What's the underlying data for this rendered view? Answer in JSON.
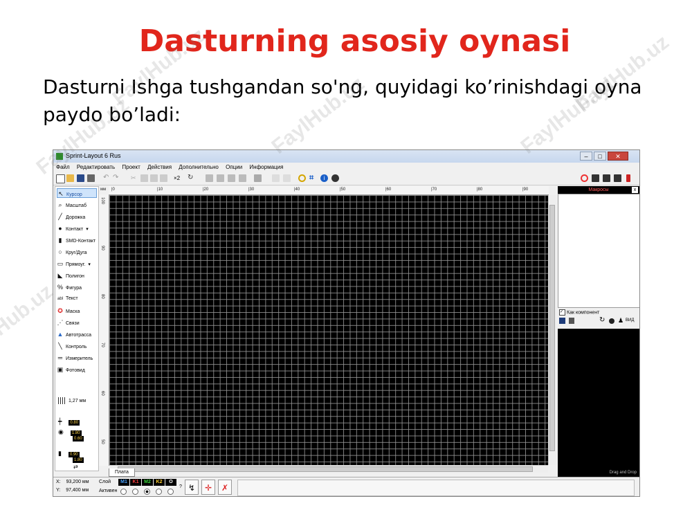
{
  "slide": {
    "title": "Dasturning asosiy oynasi",
    "intro": "Dasturni Ishga tushgandan so'ng, quyidagi ko’rinishdagi oyna paydo bo’ladi:",
    "watermark": "FaylHub.uz",
    "title_color": "#e1261c"
  },
  "window": {
    "title": "Sprint-Layout 6 Rus",
    "controls": [
      "–",
      "□",
      "✕"
    ]
  },
  "menu": [
    "Файл",
    "Редактировать",
    "Проект",
    "Действия",
    "Дополнительно",
    "Опции",
    "Информация"
  ],
  "toolbar": {
    "zoom_label": "×2"
  },
  "tools": [
    {
      "label": "Курсор",
      "icon": "cursor-icon",
      "glyph": "↖",
      "active": true
    },
    {
      "label": "Масштаб",
      "icon": "zoom-icon",
      "glyph": "🔍",
      "active": false
    },
    {
      "label": "Дорожка",
      "icon": "track-icon",
      "glyph": "╱",
      "active": false
    },
    {
      "label": "Контакт",
      "icon": "pad-icon",
      "glyph": "●",
      "active": false
    },
    {
      "label": "SMD-Контакт",
      "icon": "smd-pad-icon",
      "glyph": "▮",
      "active": false
    },
    {
      "label": "Круг/Дуга",
      "icon": "circle-icon",
      "glyph": "○",
      "active": false
    },
    {
      "label": "Прямоуг.",
      "icon": "rectangle-icon",
      "glyph": "▭",
      "active": false
    },
    {
      "label": "Полигон",
      "icon": "polygon-icon",
      "glyph": "◣",
      "active": false
    },
    {
      "label": "Фигура",
      "icon": "shape-icon",
      "glyph": "%",
      "active": false
    },
    {
      "label": "Текст",
      "icon": "text-icon",
      "glyph": "abl",
      "active": false
    },
    {
      "label": "Маска",
      "icon": "mask-icon",
      "glyph": "✪",
      "active": false
    },
    {
      "label": "Связи",
      "icon": "connections-icon",
      "glyph": "⋰",
      "active": false
    },
    {
      "label": "Автотрасса",
      "icon": "autoroute-icon",
      "glyph": "▲",
      "active": false
    },
    {
      "label": "Контроль",
      "icon": "control-icon",
      "glyph": "╲",
      "active": false
    },
    {
      "label": "Измеритель",
      "icon": "measure-icon",
      "glyph": "═",
      "active": false
    },
    {
      "label": "Фотовид",
      "icon": "photoview-icon",
      "glyph": "▣",
      "active": false
    }
  ],
  "grid_setting": "1,27 мм",
  "track_values": {
    "width": "0.80",
    "pad_outer": "1.80",
    "pad_inner": "0.60",
    "smd_w": "0.90",
    "smd_h": "1.80"
  },
  "ruler": {
    "unit": "мм",
    "top_ticks": [
      "0",
      "10",
      "20",
      "30",
      "40",
      "50",
      "60",
      "70",
      "80",
      "90"
    ],
    "left_ticks": [
      "100",
      "90",
      "80",
      "70",
      "60",
      "50"
    ]
  },
  "board_tab": "Плата",
  "macros": {
    "header": "Макросы",
    "close": "x",
    "checkbox_label": "Как компонент",
    "view_label": "ВИД",
    "drag_drop": "Drag and Drop"
  },
  "status": {
    "x_label": "X:",
    "x_value": "93,200 мм",
    "y_label": "Y:",
    "y_value": "97,400 мм",
    "layer_label": "Слой",
    "active_label": "Активен",
    "layers": [
      {
        "name": "M1",
        "color": "#4aa3ff"
      },
      {
        "name": "K1",
        "color": "#ff4040"
      },
      {
        "name": "M2",
        "color": "#37d337"
      },
      {
        "name": "K2",
        "color": "#ffd030"
      },
      {
        "name": "O",
        "color": "#ffffff"
      }
    ],
    "help": "?"
  }
}
